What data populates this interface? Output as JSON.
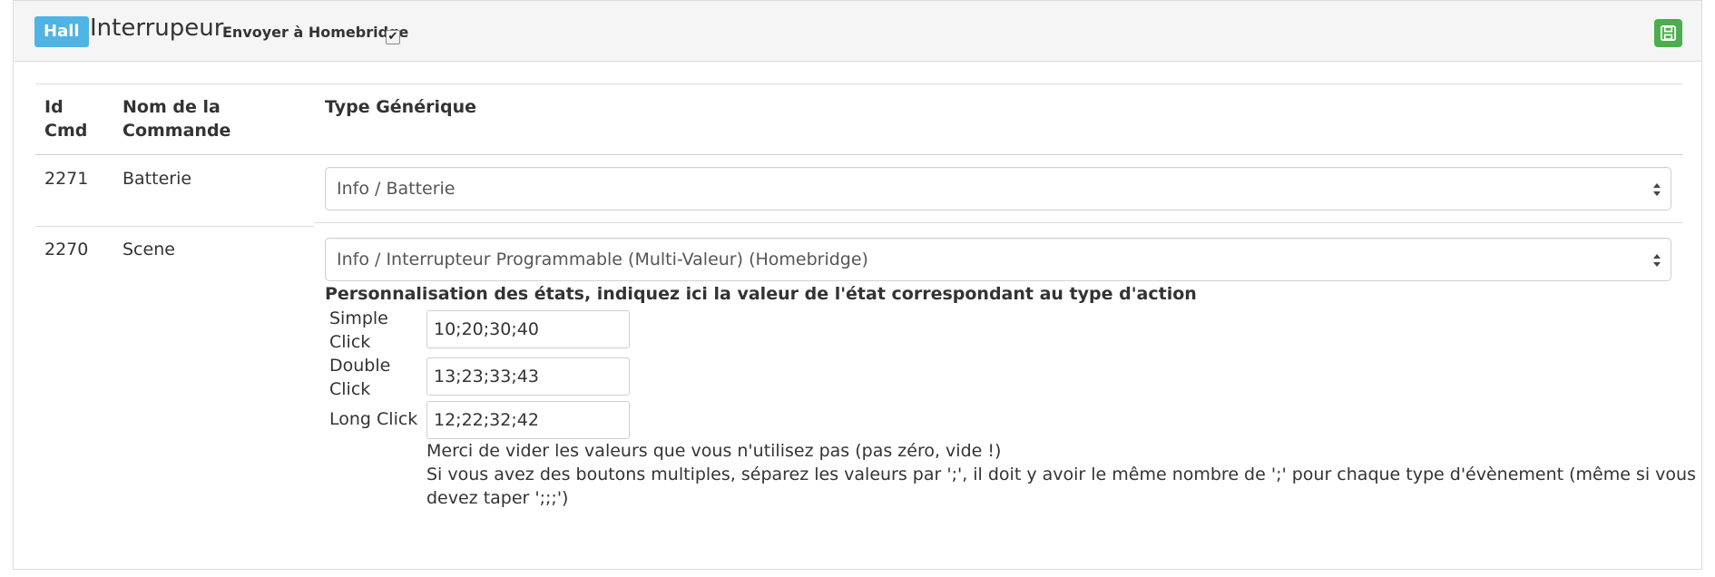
{
  "header": {
    "room_badge": "Hall",
    "device_name": "Interrupeur",
    "homebridge_label": "Envoyer à Homebridge",
    "homebridge_checked": true,
    "save_icon": "floppy-disk-icon",
    "save_color": "#4cae4c"
  },
  "table": {
    "columns": [
      "Id Cmd",
      "Nom de la Commande",
      "Type Générique"
    ],
    "col_id_line1": "Id",
    "col_id_line2": "Cmd",
    "col_name_line1": "Nom de la",
    "col_name_line2": "Commande",
    "col_type": "Type Générique",
    "rows": [
      {
        "id": "2271",
        "name": "Batterie",
        "type": "Info / Batterie"
      },
      {
        "id": "2270",
        "name": "Scene",
        "type": "Info / Interrupteur Programmable (Multi-Valeur) (Homebridge)"
      }
    ]
  },
  "personalisation": {
    "title": "Personnalisation des états, indiquez ici la valeur de l'état correspondant au type d'action",
    "fields": [
      {
        "label_line1": "Simple",
        "label_line2": "Click",
        "value": "10;20;30;40"
      },
      {
        "label_line1": "Double",
        "label_line2": "Click",
        "value": "13;23;33;43"
      },
      {
        "label_line1": "Long Click",
        "label_line2": "",
        "value": "12;22;32;42"
      }
    ],
    "help_line1": "Merci de vider les valeurs que vous n'utilisez pas (pas zéro, vide !)",
    "help_line2": "Si vous avez des boutons multiples, séparez les valeurs par ';', il doit y avoir le même nombre de ';' pour chaque type d'évènement (même si vous",
    "help_line3": "devez taper ';;;')"
  }
}
